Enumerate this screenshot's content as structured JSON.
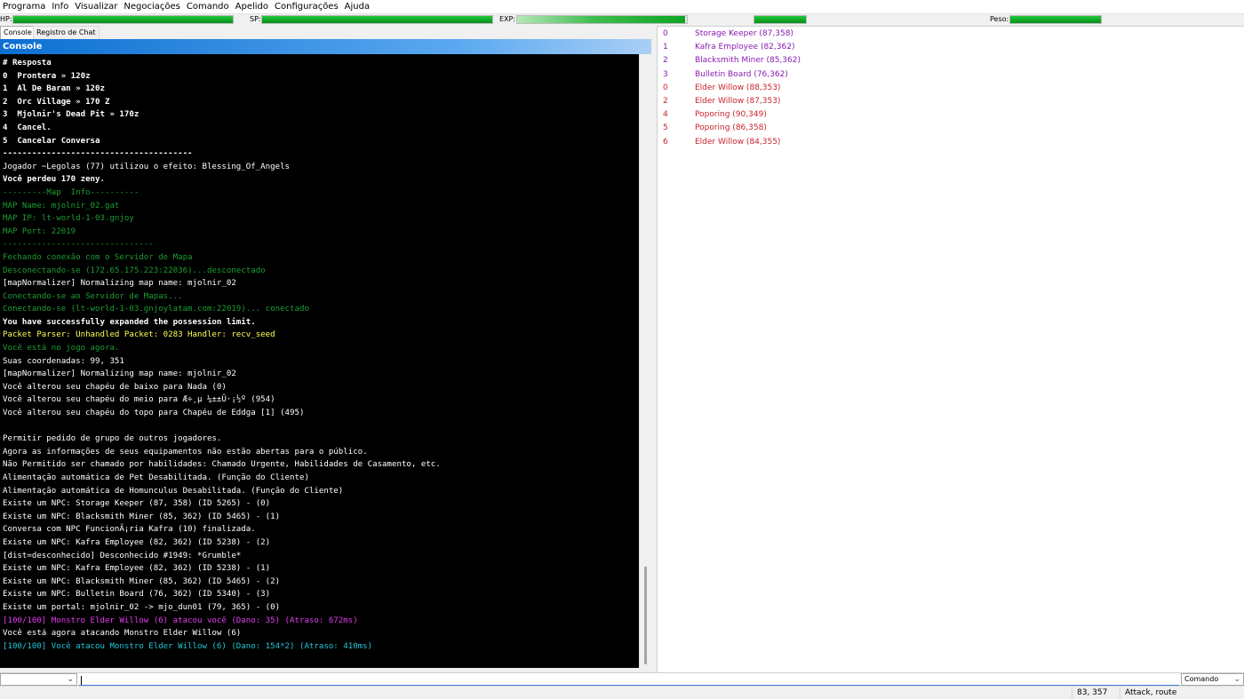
{
  "menu": [
    "Programa",
    "Info",
    "Visualizar",
    "Negociações",
    "Comando",
    "Apelido",
    "Configurações",
    "Ajuda"
  ],
  "stats": {
    "hp_label": "HP:",
    "sp_label": "SP:",
    "exp_label": "EXP:",
    "weight_label": "Peso:",
    "hp_fill": 1.0,
    "sp_fill": 1.0,
    "exp_fill": 0.99,
    "job_exp_fill": 1.0,
    "weight_fill": 1.0
  },
  "tabs": [
    "Console",
    "Registro de Chat"
  ],
  "console_title": "Console",
  "console_lines": [
    {
      "text": "# Resposta",
      "color": "wb"
    },
    {
      "text": "0  Prontera » 120z",
      "color": "wb"
    },
    {
      "text": "1  Al De Baran » 120z",
      "color": "wb"
    },
    {
      "text": "2  Orc Village » 170 Z",
      "color": "wb"
    },
    {
      "text": "3  Mjolnir's Dead Pit » 170z",
      "color": "wb"
    },
    {
      "text": "4  Cancel.",
      "color": "wb"
    },
    {
      "text": "5  Cancelar Conversa",
      "color": "wb"
    },
    {
      "text": "---------------------------------------",
      "color": "wb"
    },
    {
      "text": "Jogador ~Legolas (77) utilizou o efeito: Blessing_Of_Angels",
      "color": "w"
    },
    {
      "text": "Você perdeu 170 zeny.",
      "color": "wb"
    },
    {
      "text": "---------Map  Info----------",
      "color": "g"
    },
    {
      "text": "MAP Name: mjolnir_02.gat",
      "color": "g"
    },
    {
      "text": "MAP IP: lt-world-1-03.gnjoy",
      "color": "g"
    },
    {
      "text": "MAP Port: 22019",
      "color": "g"
    },
    {
      "text": "-------------------------------",
      "color": "g"
    },
    {
      "text": "Fechando conexão com o Servidor de Mapa",
      "color": "g"
    },
    {
      "text": "Desconectando-se (172.65.175.223:22036)...desconectado",
      "color": "g"
    },
    {
      "text": "[mapNormalizer] Normalizing map name: mjolnir_02",
      "color": "w"
    },
    {
      "text": "Conectando-se ao Servidor de Mapas...",
      "color": "g"
    },
    {
      "text": "Conectando-se (lt-world-1-03.gnjoylatam.com:22019)... conectado",
      "color": "g"
    },
    {
      "text": "You have successfully expanded the possession limit.",
      "color": "wb"
    },
    {
      "text": "Packet Parser: Unhandled Packet: 0283 Handler: recv_seed",
      "color": "y"
    },
    {
      "text": "Você está no jogo agora.",
      "color": "g"
    },
    {
      "text": "Suas coordenadas: 99, 351",
      "color": "w"
    },
    {
      "text": "[mapNormalizer] Normalizing map name: mjolnir_02",
      "color": "w"
    },
    {
      "text": "Você alterou seu chapéu de baixo para Nada (0)",
      "color": "w"
    },
    {
      "text": "Você alterou seu chapéu do meio para Æ÷¸µ ¼±±Û·¡½º (954)",
      "color": "w"
    },
    {
      "text": "Você alterou seu chapéu do topo para Chapéu de Eddga [1] (495)",
      "color": "w"
    },
    {
      "text": "",
      "color": "w"
    },
    {
      "text": "Permitir pedido de grupo de outros jogadores.",
      "color": "w"
    },
    {
      "text": "Agora as informações de seus equipamentos não estão abertas para o público.",
      "color": "w"
    },
    {
      "text": "Não Permitido ser chamado por habilidades: Chamado Urgente, Habilidades de Casamento, etc.",
      "color": "w"
    },
    {
      "text": "Alimentação automática de Pet Desabilitada. (Função do Cliente)",
      "color": "w"
    },
    {
      "text": "Alimentação automática de Homunculus Desabilitada. (Função do Cliente)",
      "color": "w"
    },
    {
      "text": "Existe um NPC: Storage Keeper (87, 358) (ID 5265) - (0)",
      "color": "w"
    },
    {
      "text": "Existe um NPC: Blacksmith Miner (85, 362) (ID 5465) - (1)",
      "color": "w"
    },
    {
      "text": "Conversa com NPC FuncionÃ¡ria Kafra (10) finalizada.",
      "color": "w"
    },
    {
      "text": "Existe um NPC: Kafra Employee (82, 362) (ID 5238) - (2)",
      "color": "w"
    },
    {
      "text": "[dist=desconhecido] Desconhecido #1949: *Grumble*",
      "color": "w"
    },
    {
      "text": "Existe um NPC: Kafra Employee (82, 362) (ID 5238) - (1)",
      "color": "w"
    },
    {
      "text": "Existe um NPC: Blacksmith Miner (85, 362) (ID 5465) - (2)",
      "color": "w"
    },
    {
      "text": "Existe um NPC: Bulletin Board (76, 362) (ID 5340) - (3)",
      "color": "w"
    },
    {
      "text": "Existe um portal: mjolnir_02 -> mjo_dun01 (79, 365) - (0)",
      "color": "w"
    },
    {
      "text": "[100/100] Monstro Elder Willow (6) atacou você (Dano: 35) (Atraso: 672ms)",
      "color": "m"
    },
    {
      "text": "Você está agora atacando Monstro Elder Willow (6)",
      "color": "w"
    },
    {
      "text": "[100/100] Você atacou Monstro Elder Willow (6) (Dano: 154*2) (Atraso: 410ms)",
      "color": "c"
    }
  ],
  "npc_list": [
    {
      "index": "0",
      "name": "Storage Keeper (87,358)",
      "kind": "npc"
    },
    {
      "index": "1",
      "name": "Kafra Employee (82,362)",
      "kind": "npc"
    },
    {
      "index": "2",
      "name": "Blacksmith Miner (85,362)",
      "kind": "npc"
    },
    {
      "index": "3",
      "name": "Bulletin Board (76,362)",
      "kind": "npc"
    },
    {
      "index": "0",
      "name": "Elder Willow (88,353)",
      "kind": "monster"
    },
    {
      "index": "2",
      "name": "Elder Willow (87,353)",
      "kind": "monster"
    },
    {
      "index": "4",
      "name": "Poporing (90,349)",
      "kind": "monster"
    },
    {
      "index": "5",
      "name": "Poporing (86,358)",
      "kind": "monster"
    },
    {
      "index": "6",
      "name": "Elder Willow (84,355)",
      "kind": "monster"
    }
  ],
  "command_input": {
    "value": ""
  },
  "command_select": "Comando",
  "status": {
    "coords": "83, 357",
    "action": "Attack, route"
  }
}
